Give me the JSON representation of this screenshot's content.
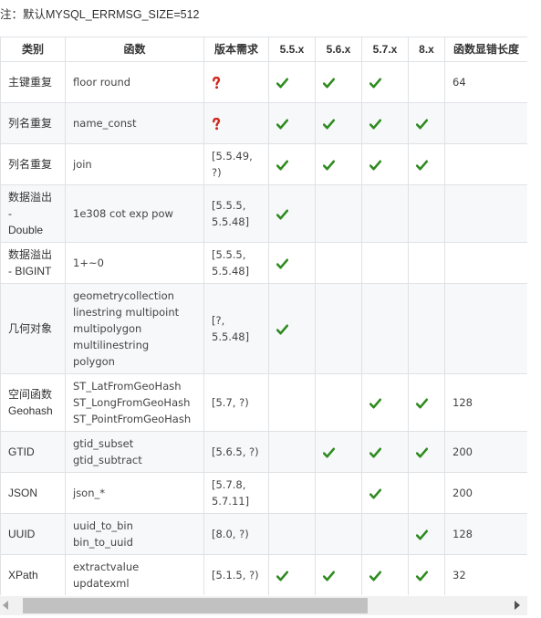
{
  "note": "注：默认MYSQL_ERRMSG_SIZE=512",
  "headers": [
    "类别",
    "函数",
    "版本需求",
    "5.5.x",
    "5.6.x",
    "5.7.x",
    "8.x",
    "函数显错长度"
  ],
  "rows": [
    {
      "category": [
        "主键重复"
      ],
      "functions": [
        "floor round"
      ],
      "version": null,
      "version_icon": "question-mark-icon",
      "v55": true,
      "v56": true,
      "v57": true,
      "v8": false,
      "length": "64"
    },
    {
      "category": [
        "列名重复"
      ],
      "functions": [
        "name_const"
      ],
      "version": null,
      "version_icon": "question-mark-icon",
      "v55": true,
      "v56": true,
      "v57": true,
      "v8": true,
      "length": ""
    },
    {
      "category": [
        "列名重复"
      ],
      "functions": [
        "join"
      ],
      "version": [
        "[5.5.49,",
        "?)"
      ],
      "v55": true,
      "v56": true,
      "v57": true,
      "v8": true,
      "length": ""
    },
    {
      "category": [
        "数据溢出",
        "-",
        "Double"
      ],
      "functions": [
        "1e308 cot exp pow"
      ],
      "version": [
        "[5.5.5,",
        "5.5.48]"
      ],
      "v55": true,
      "v56": false,
      "v57": false,
      "v8": false,
      "length": ""
    },
    {
      "category": [
        "数据溢出",
        "- BIGINT"
      ],
      "functions": [
        "1+~0"
      ],
      "version": [
        "[5.5.5,",
        "5.5.48]"
      ],
      "v55": true,
      "v56": false,
      "v57": false,
      "v8": false,
      "length": ""
    },
    {
      "category": [
        "几何对象"
      ],
      "functions": [
        "geometrycollection",
        "linestring multipoint",
        "multipolygon",
        "multilinestring",
        "polygon"
      ],
      "version": [
        "[?,",
        "5.5.48]"
      ],
      "v55": true,
      "v56": false,
      "v57": false,
      "v8": false,
      "length": ""
    },
    {
      "category": [
        "空间函数",
        "Geohash"
      ],
      "functions": [
        "ST_LatFromGeoHash",
        "ST_LongFromGeoHash",
        "ST_PointFromGeoHash"
      ],
      "version": [
        "[5.7, ?)"
      ],
      "v55": false,
      "v56": false,
      "v57": true,
      "v8": true,
      "length": "128"
    },
    {
      "category": [
        "GTID"
      ],
      "functions": [
        "gtid_subset",
        "gtid_subtract"
      ],
      "version": [
        "[5.6.5, ?)"
      ],
      "v55": false,
      "v56": true,
      "v57": true,
      "v8": true,
      "length": "200"
    },
    {
      "category": [
        "JSON"
      ],
      "functions": [
        "json_*"
      ],
      "version": [
        "[5.7.8,",
        "5.7.11]"
      ],
      "v55": false,
      "v56": false,
      "v57": true,
      "v8": false,
      "length": "200"
    },
    {
      "category": [
        "UUID"
      ],
      "functions": [
        "uuid_to_bin",
        "bin_to_uuid"
      ],
      "version": [
        "[8.0, ?)"
      ],
      "v55": false,
      "v56": false,
      "v57": false,
      "v8": true,
      "length": "128"
    },
    {
      "category": [
        "XPath"
      ],
      "functions": [
        "extractvalue",
        "updatexml"
      ],
      "version": [
        "[5.1.5, ?)"
      ],
      "v55": true,
      "v56": true,
      "v57": true,
      "v8": true,
      "length": "32"
    }
  ],
  "colors": {
    "check": "#2e8b1f",
    "question": "#d0281c",
    "border": "#dfe2e5",
    "stripe": "#f6f8fa"
  },
  "icons": {
    "check": "check-mark-icon",
    "question": "question-mark-icon"
  }
}
